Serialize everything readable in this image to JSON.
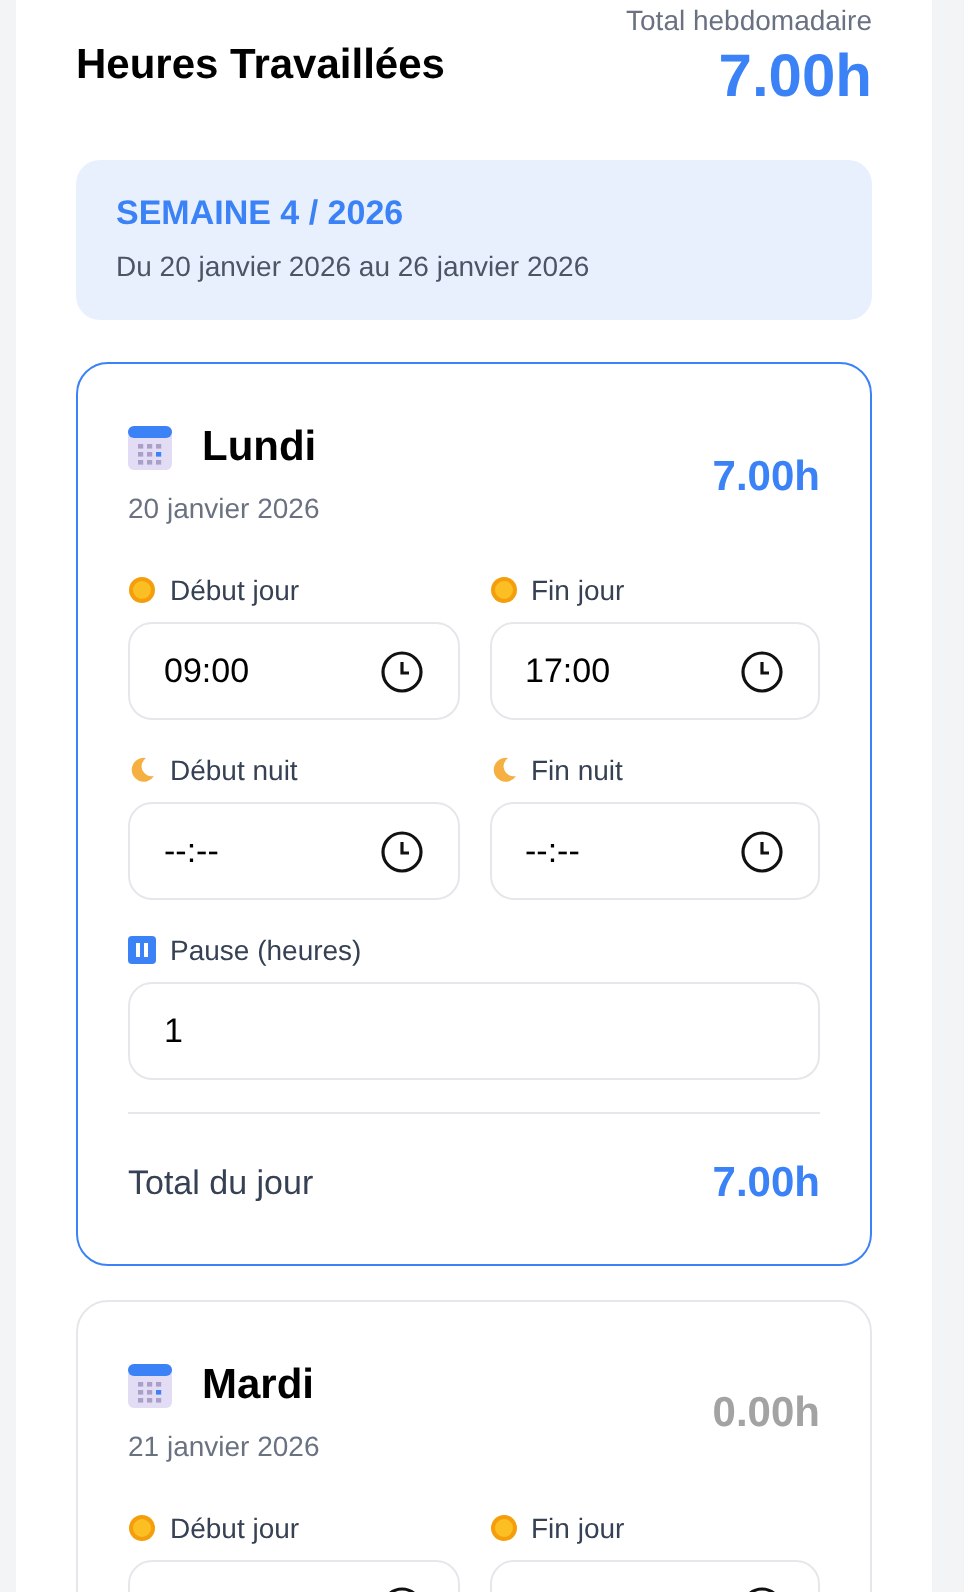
{
  "header": {
    "title": "Heures Travaillées",
    "total_label": "Total hebdomadaire",
    "total_value": "7.00h"
  },
  "week": {
    "title": "SEMAINE 4 / 2026",
    "range": "Du 20 janvier 2026 au 26 janvier 2026"
  },
  "days": [
    {
      "name": "Lundi",
      "date": "20 janvier 2026",
      "total": "7.00h",
      "selected": true,
      "fields": [
        {
          "kind": "day",
          "label": "Début jour",
          "value": "09:00"
        },
        {
          "kind": "day",
          "label": "Fin jour",
          "value": "17:00"
        },
        {
          "kind": "night",
          "label": "Début nuit",
          "value": "--:--"
        },
        {
          "kind": "night",
          "label": "Fin nuit",
          "value": "--:--"
        },
        {
          "kind": "pause",
          "label": "Pause (heures)",
          "value": "1"
        }
      ],
      "footer": {
        "label": "Total du jour",
        "value": "7.00h"
      }
    },
    {
      "name": "Mardi",
      "date": "21 janvier 2026",
      "total": "0.00h",
      "selected": false,
      "fields": [
        {
          "kind": "day",
          "label": "Début jour"
        },
        {
          "kind": "day",
          "label": "Fin jour"
        }
      ]
    }
  ]
}
